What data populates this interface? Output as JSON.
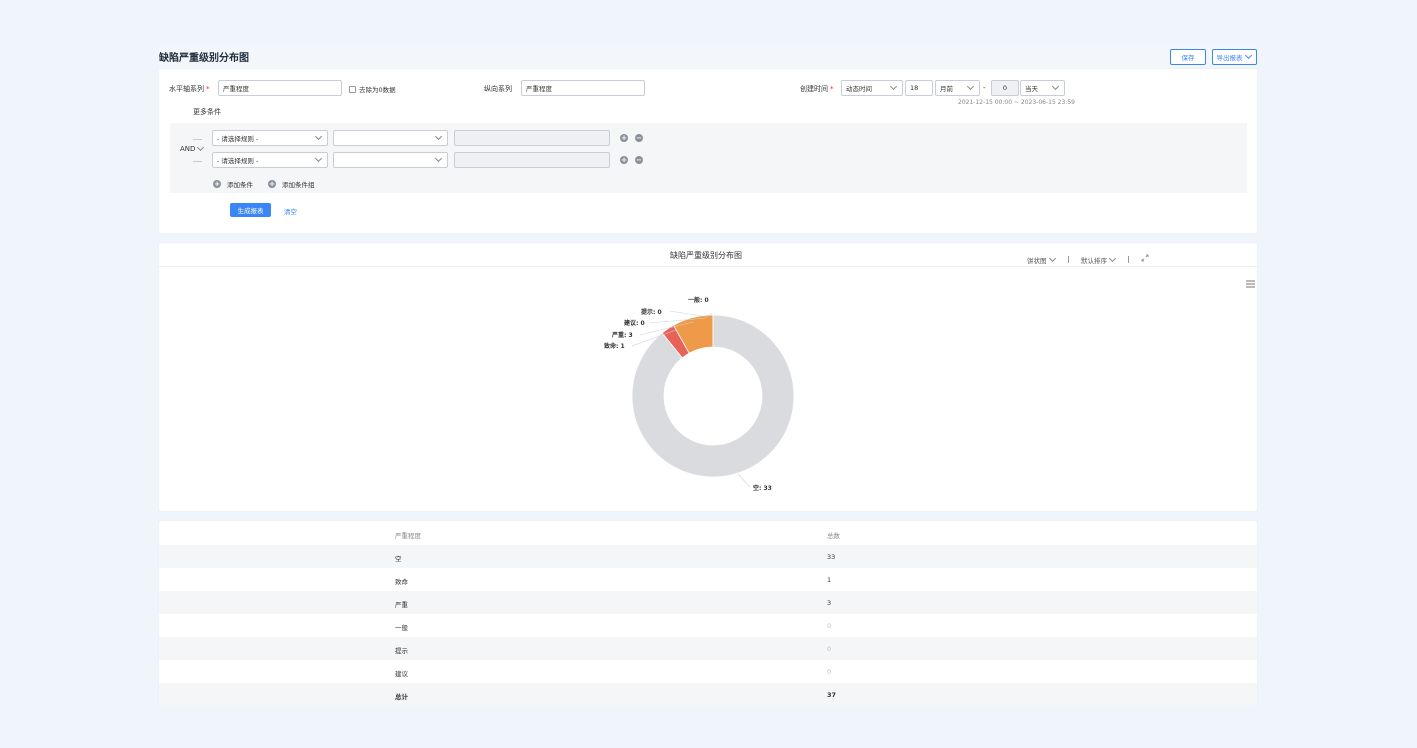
{
  "header": {
    "title": "缺陷严重级别分布图",
    "save_label": "保存",
    "export_label": "导出报表"
  },
  "filters": {
    "x_axis_label": "水平轴系列",
    "x_axis_value": "严重程度",
    "remove_zero_label": "去除为0数据",
    "y_axis_label": "纵向系列",
    "y_axis_value": "严重程度",
    "created_label": "创建时间",
    "time_mode": "动态时间",
    "time_amount": "18",
    "time_unit": "月前",
    "dash": "-",
    "time_end_amount": "0",
    "time_end_unit": "当天",
    "time_range_hint": "2021-12-15 00:00 ~ 2023-06-15 23:59",
    "more_conditions": "更多条件",
    "logic": "AND",
    "rule_placeholder": "- 请选择规则 -",
    "add_condition": "添加条件",
    "add_condition_group": "添加条件组",
    "generate_label": "生成报表",
    "clear_label": "清空"
  },
  "chart_panel": {
    "title": "缺陷严重级别分布图",
    "chart_type": "饼状图",
    "sort": "默认排序",
    "sep": "|"
  },
  "chart_data": {
    "type": "pie",
    "donut": true,
    "slices": [
      {
        "label": "空",
        "value": 33,
        "color": "#d9dbdf"
      },
      {
        "label": "致命",
        "value": 1,
        "color": "#e8625a"
      },
      {
        "label": "严重",
        "value": 3,
        "color": "#ef9a48"
      },
      {
        "label": "一般",
        "value": 0,
        "color": "#7fbbe8"
      },
      {
        "label": "提示",
        "value": 0,
        "color": "#7fbbe8"
      },
      {
        "label": "建议",
        "value": 0,
        "color": "#7fbbe8"
      }
    ],
    "data_labels": [
      "一般: 0",
      "提示: 0",
      "建议: 0",
      "严重: 3",
      "致命: 1",
      "空: 33"
    ]
  },
  "table": {
    "headers": [
      "严重程度",
      "总数"
    ],
    "rows": [
      {
        "name": "空",
        "count": "33"
      },
      {
        "name": "致命",
        "count": "1"
      },
      {
        "name": "严重",
        "count": "3"
      },
      {
        "name": "一般",
        "count": "0"
      },
      {
        "name": "提示",
        "count": "0"
      },
      {
        "name": "建议",
        "count": "0"
      }
    ],
    "total_label": "总计",
    "total_count": "37"
  }
}
